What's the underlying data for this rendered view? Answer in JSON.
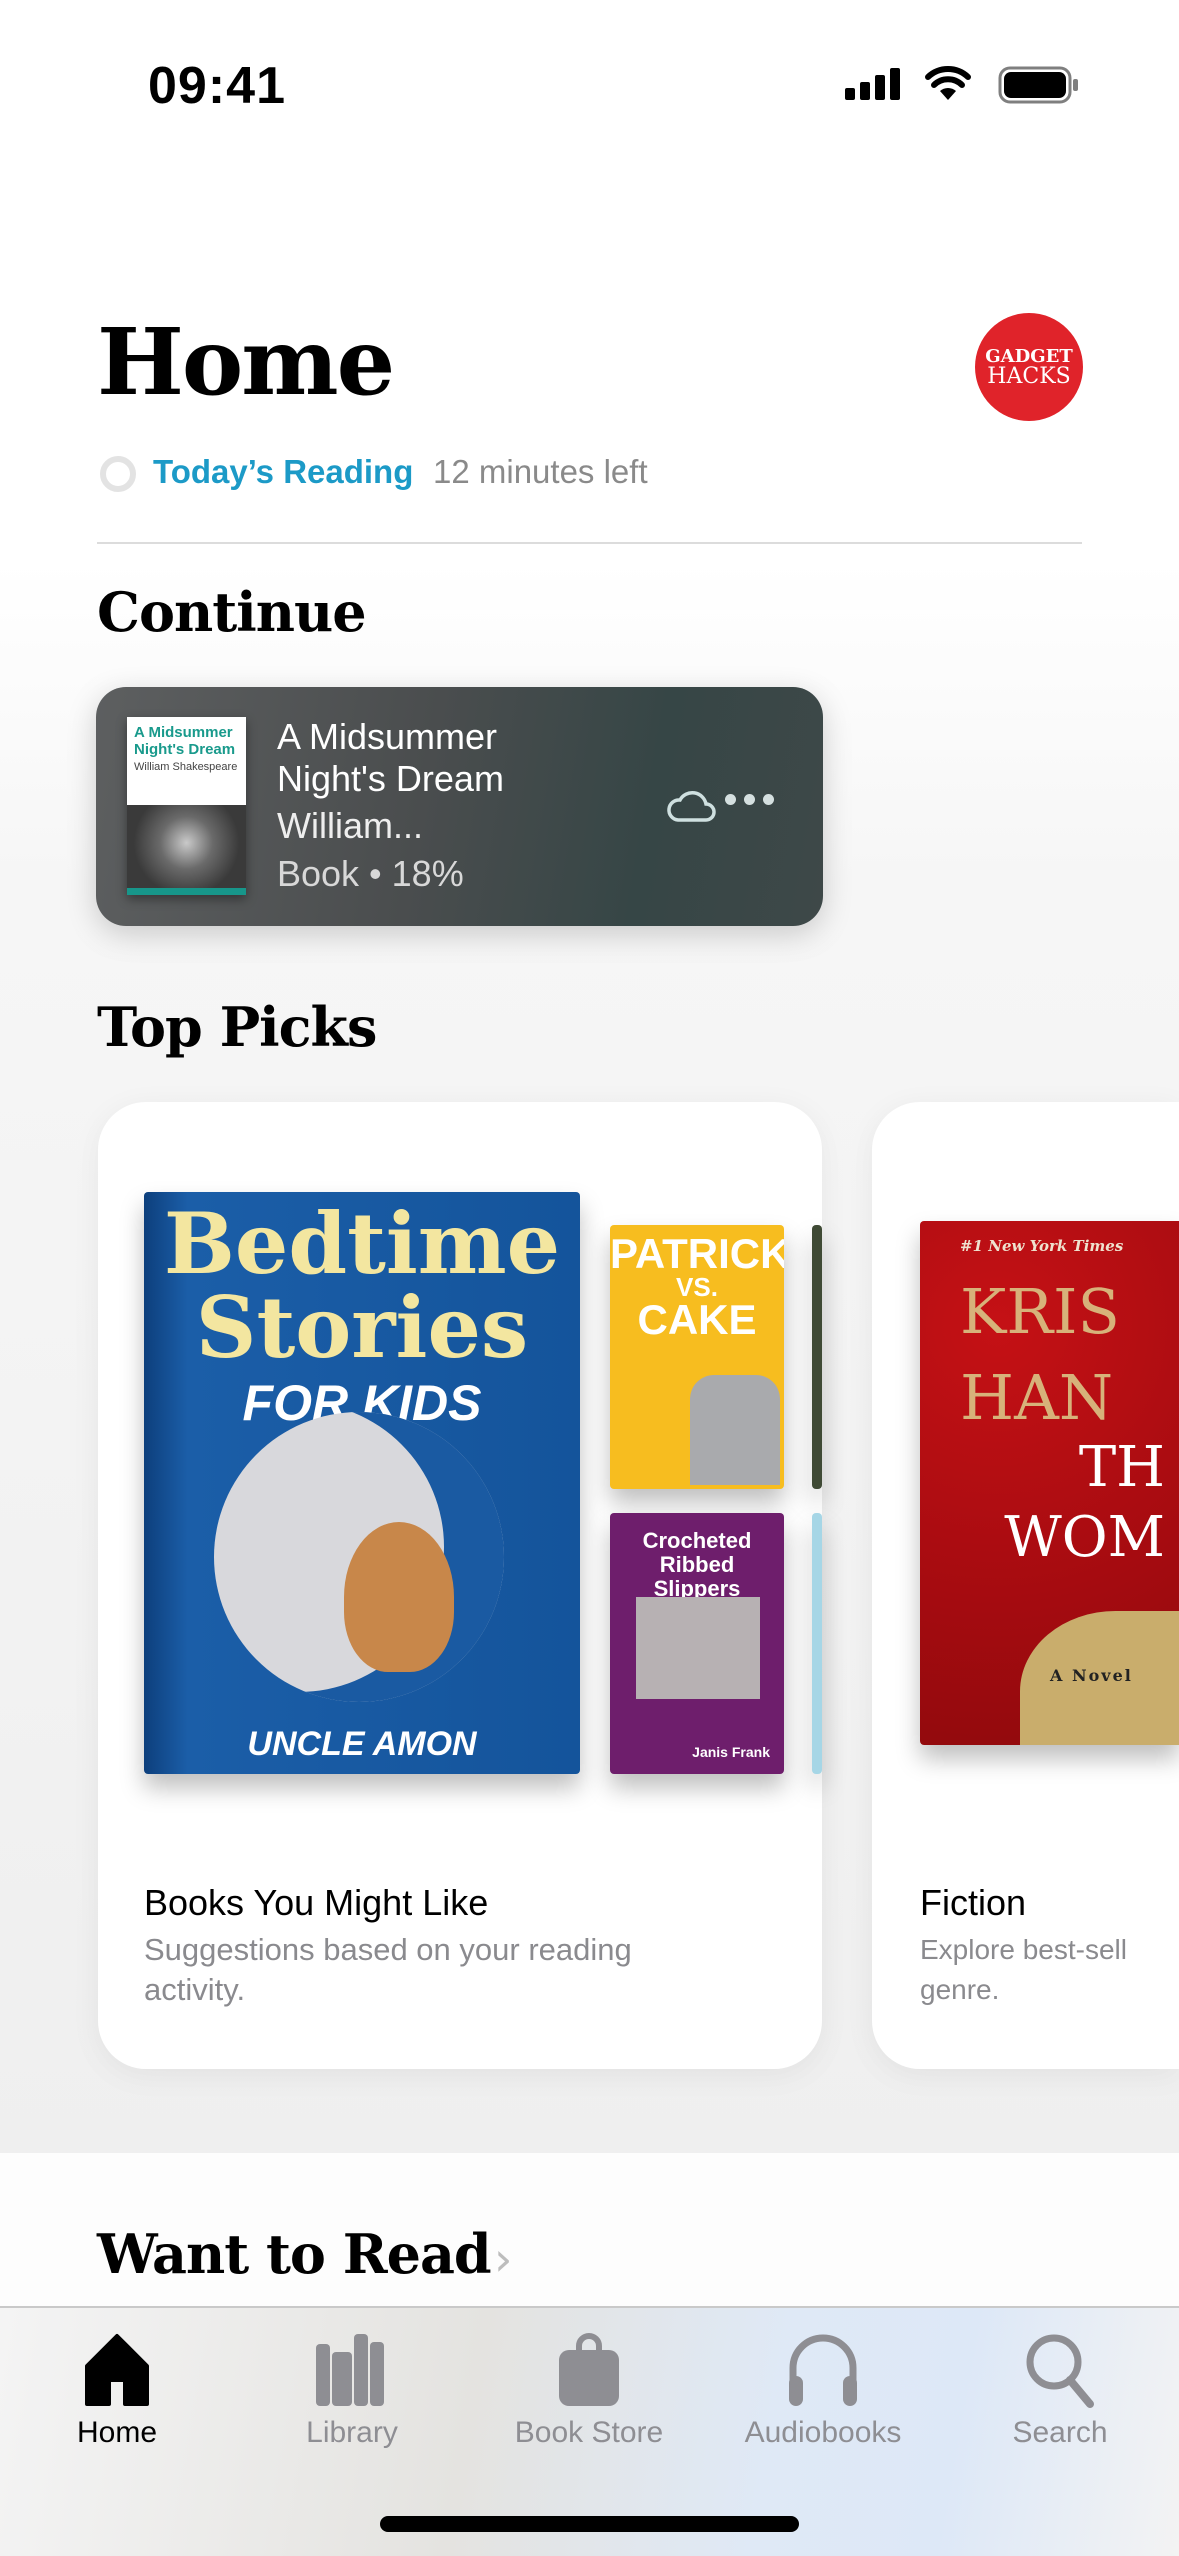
{
  "status_bar": {
    "time": "09:41",
    "icons": [
      "cellular-signal-icon",
      "wifi-icon",
      "battery-icon"
    ]
  },
  "header": {
    "title": "Home",
    "avatar_text": [
      "GADGET",
      "HACKS"
    ],
    "avatar_color": "#e0232a",
    "reading_goal": {
      "label": "Today’s Reading",
      "remaining": "12 minutes left",
      "progress": 0
    }
  },
  "continue": {
    "heading": "Continue",
    "book": {
      "title_lines": [
        "A Midsummer",
        "Night's Dream"
      ],
      "author": "William...",
      "meta": "Book • 18%",
      "progress_percent": 18,
      "cover": {
        "title": "A Midsummer Night's Dream",
        "author": "William Shakespeare"
      }
    }
  },
  "top_picks": {
    "heading": "Top Picks",
    "cards": [
      {
        "title": "Books You Might Like",
        "subtitle": "Suggestions based on your reading activity.",
        "covers": [
          {
            "lines": [
              "Bedtime Stories",
              "FOR KIDS",
              "UNCLE AMON"
            ]
          },
          {
            "lines": [
              "PATRICK",
              "VS.",
              "CAKE"
            ]
          },
          {
            "lines": [
              "Crocheted Ribbed Slippers",
              "Janis Frank"
            ]
          }
        ]
      },
      {
        "title": "Fiction",
        "subtitle": "Explore best-sell... genre.",
        "subtitle_visible": [
          "Explore best-sell",
          "genre."
        ],
        "covers": [
          {
            "lines": [
              "#1 New York Times",
              "KRIS",
              "HAN",
              "TH",
              "WOM",
              "A Novel"
            ]
          }
        ]
      }
    ]
  },
  "want_to_read": {
    "heading": "Want to Read"
  },
  "tab_bar": {
    "items": [
      {
        "label": "Home",
        "icon": "house-icon",
        "active": true
      },
      {
        "label": "Library",
        "icon": "books-icon"
      },
      {
        "label": "Book Store",
        "icon": "bag-icon"
      },
      {
        "label": "Audiobooks",
        "icon": "headphones-icon"
      },
      {
        "label": "Search",
        "icon": "magnifier-icon"
      }
    ]
  }
}
